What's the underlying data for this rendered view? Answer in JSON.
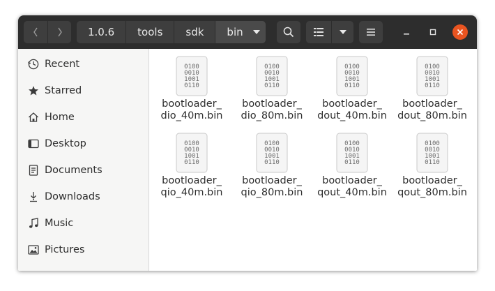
{
  "colors": {
    "headerbar": "#2d2d2d",
    "button": "#3e3e3e",
    "close": "#e95420",
    "sidebar": "#f6f6f5"
  },
  "nav": {
    "back_icon": "go-back-icon",
    "forward_icon": "go-forward-icon"
  },
  "breadcrumb": [
    "1.0.6",
    "tools",
    "sdk",
    "bin"
  ],
  "toolbar": {
    "search_icon": "search-icon",
    "view_icon": "list-view-icon",
    "view_options_icon": "chevron-down-icon",
    "menu_icon": "hamburger-menu-icon"
  },
  "sidebar": {
    "items": [
      {
        "label": "Recent",
        "icon": "clock-icon"
      },
      {
        "label": "Starred",
        "icon": "star-icon"
      },
      {
        "label": "Home",
        "icon": "home-icon"
      },
      {
        "label": "Desktop",
        "icon": "desktop-icon"
      },
      {
        "label": "Documents",
        "icon": "document-icon"
      },
      {
        "label": "Downloads",
        "icon": "download-icon"
      },
      {
        "label": "Music",
        "icon": "music-icon"
      },
      {
        "label": "Pictures",
        "icon": "picture-icon"
      }
    ]
  },
  "files": [
    {
      "line1": "bootloader_",
      "line2": "dio_40m.bin"
    },
    {
      "line1": "bootloader_",
      "line2": "dio_80m.bin"
    },
    {
      "line1": "bootloader_",
      "line2": "dout_40m.bin"
    },
    {
      "line1": "bootloader_",
      "line2": "dout_80m.bin"
    },
    {
      "line1": "bootloader_",
      "line2": "qio_40m.bin"
    },
    {
      "line1": "bootloader_",
      "line2": "qio_80m.bin"
    },
    {
      "line1": "bootloader_",
      "line2": "qout_40m.bin"
    },
    {
      "line1": "bootloader_",
      "line2": "qout_80m.bin"
    }
  ],
  "binary_glyph": [
    "0100",
    "0010",
    "1001",
    "0110"
  ]
}
